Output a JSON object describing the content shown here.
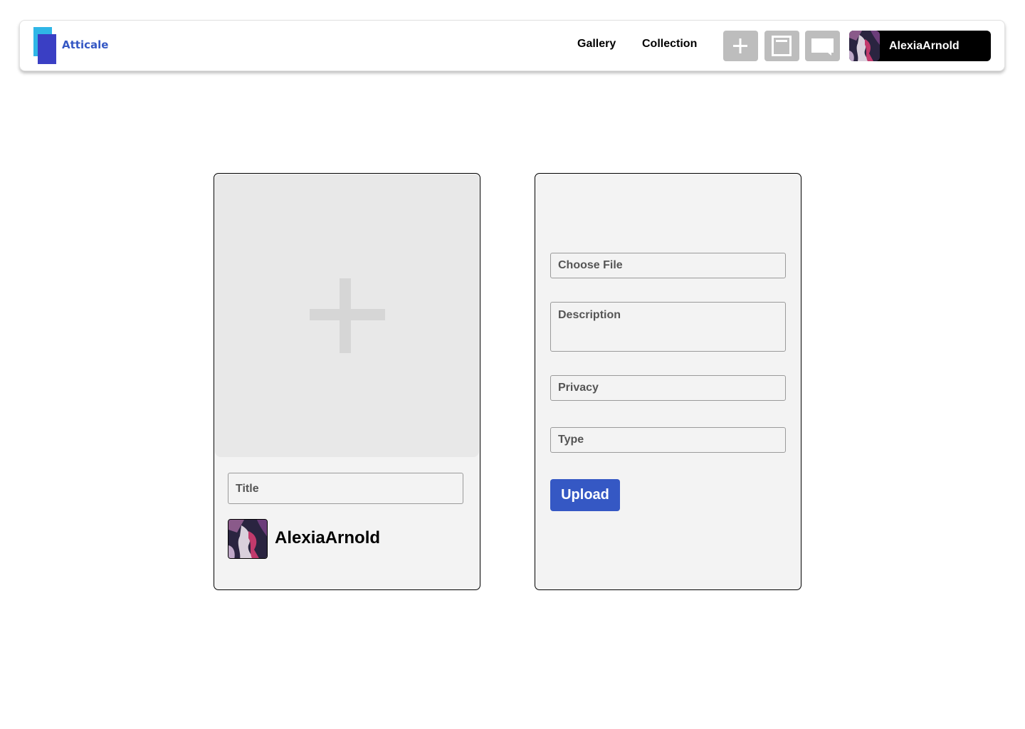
{
  "app": {
    "name": "Atticale"
  },
  "nav": {
    "links": [
      {
        "label": "Gallery"
      },
      {
        "label": "Collection"
      }
    ],
    "icons": [
      "plus-icon",
      "document-icon",
      "chat-icon"
    ],
    "user": {
      "username": "AlexiaArnold"
    }
  },
  "preview_card": {
    "upload_placeholder_icon": "plus-icon",
    "title_placeholder": "Title",
    "author": "AlexiaArnold"
  },
  "form": {
    "file_label": "Choose File",
    "description_placeholder": "Description",
    "privacy_placeholder": "Privacy",
    "type_placeholder": "Type",
    "submit_label": "Upload"
  },
  "colors": {
    "brand": "#3558c4",
    "logo_light": "#2fb6e6",
    "logo_dark": "#3a3fc4",
    "icon_button_bg": "#bdbdbd",
    "card_bg": "#f3f3f3"
  }
}
